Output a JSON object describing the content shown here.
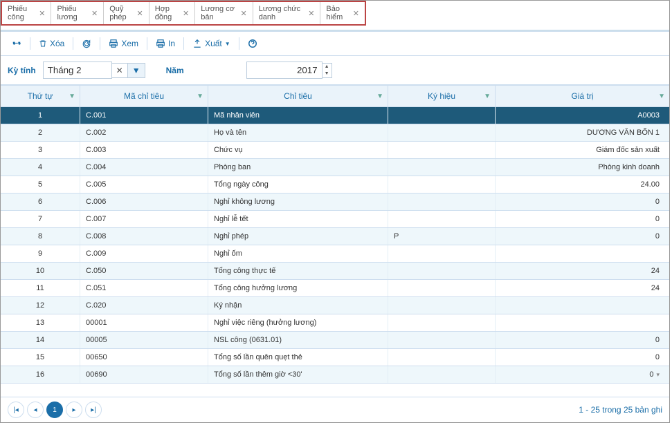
{
  "tabs": [
    {
      "label": "Phiếu công"
    },
    {
      "label": "Phiếu lương"
    },
    {
      "label": "Quỹ phép"
    },
    {
      "label": "Hợp đồng"
    },
    {
      "label": "Lương cơ bản"
    },
    {
      "label": "Lương chức danh"
    },
    {
      "label": "Bảo hiểm"
    }
  ],
  "toolbar": {
    "delete": "Xóa",
    "view": "Xem",
    "print": "In",
    "export": "Xuất"
  },
  "filters": {
    "period_label": "Kỳ tính",
    "period_value": "Tháng 2",
    "year_label": "Năm",
    "year_value": "2017"
  },
  "grid": {
    "headers": {
      "tt": "Thứ tự",
      "ma": "Mã chỉ tiêu",
      "chi": "Chỉ tiêu",
      "kh": "Ký hiệu",
      "gt": "Giá trị"
    },
    "rows": [
      {
        "tt": "1",
        "ma": "C.001",
        "chi": "Mã nhân viên",
        "kh": "",
        "gt": "A0003",
        "sel": true
      },
      {
        "tt": "2",
        "ma": "C.002",
        "chi": "Họ và tên",
        "kh": "",
        "gt": "DƯƠNG VĂN BỐN 1"
      },
      {
        "tt": "3",
        "ma": "C.003",
        "chi": "Chức vụ",
        "kh": "",
        "gt": "Giám đốc sản xuất"
      },
      {
        "tt": "4",
        "ma": "C.004",
        "chi": "Phòng ban",
        "kh": "",
        "gt": "Phòng kinh doanh"
      },
      {
        "tt": "5",
        "ma": "C.005",
        "chi": "Tổng ngày công",
        "kh": "",
        "gt": "24.00"
      },
      {
        "tt": "6",
        "ma": "C.006",
        "chi": "Nghỉ không lương",
        "kh": "",
        "gt": "0"
      },
      {
        "tt": "7",
        "ma": "C.007",
        "chi": "Nghỉ lễ tết",
        "kh": "",
        "gt": "0"
      },
      {
        "tt": "8",
        "ma": "C.008",
        "chi": "Nghỉ phép",
        "kh": "P",
        "gt": "0"
      },
      {
        "tt": "9",
        "ma": "C.009",
        "chi": "Nghỉ ốm",
        "kh": "",
        "gt": ""
      },
      {
        "tt": "10",
        "ma": "C.050",
        "chi": "Tổng công thực tế",
        "kh": "",
        "gt": "24"
      },
      {
        "tt": "11",
        "ma": "C.051",
        "chi": "Tổng công hưởng lương",
        "kh": "",
        "gt": "24"
      },
      {
        "tt": "12",
        "ma": "C.020",
        "chi": "Ký nhận",
        "kh": "",
        "gt": ""
      },
      {
        "tt": "13",
        "ma": "00001",
        "chi": "Nghỉ việc riêng (hưởng lương)",
        "kh": "",
        "gt": ""
      },
      {
        "tt": "14",
        "ma": "00005",
        "chi": "NSL công (0631.01)",
        "kh": "",
        "gt": "0"
      },
      {
        "tt": "15",
        "ma": "00650",
        "chi": "Tổng số lần quên quẹt thẻ",
        "kh": "",
        "gt": "0"
      },
      {
        "tt": "16",
        "ma": "00690",
        "chi": "Tổng số lần thêm giờ <30'",
        "kh": "",
        "gt": "0",
        "chev": true
      }
    ]
  },
  "pager": {
    "page": "1",
    "info": "1 - 25 trong 25 bản ghi"
  }
}
